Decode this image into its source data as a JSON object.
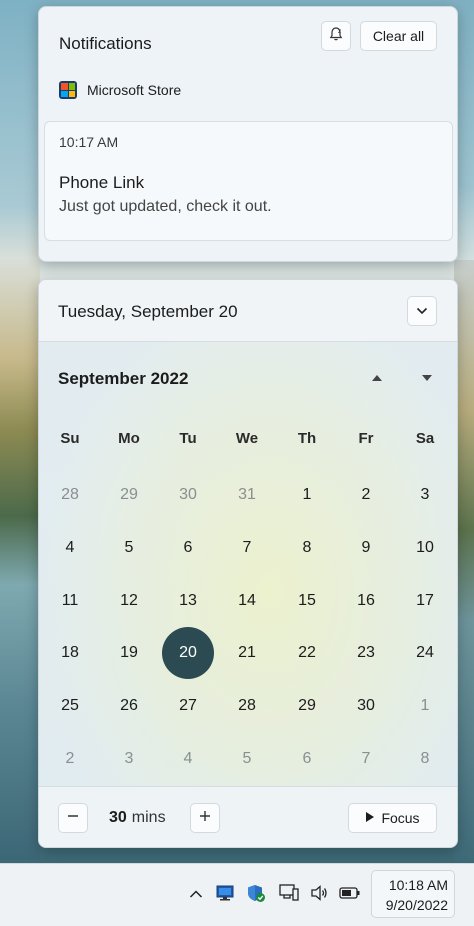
{
  "notifications": {
    "title": "Notifications",
    "do_not_disturb_icon": "bell-snooze-icon",
    "clear_all_label": "Clear all",
    "app_name": "Microsoft Store",
    "card": {
      "time": "10:17 AM",
      "title": "Phone Link",
      "body": "Just got updated, check it out."
    }
  },
  "calendar": {
    "header_date": "Tuesday, September 20",
    "month_label": "September 2022",
    "weekdays": [
      "Su",
      "Mo",
      "Tu",
      "We",
      "Th",
      "Fr",
      "Sa"
    ],
    "weeks": [
      [
        {
          "d": "28",
          "muted": true
        },
        {
          "d": "29",
          "muted": true
        },
        {
          "d": "30",
          "muted": true
        },
        {
          "d": "31",
          "muted": true
        },
        {
          "d": "1"
        },
        {
          "d": "2"
        },
        {
          "d": "3"
        }
      ],
      [
        {
          "d": "4"
        },
        {
          "d": "5"
        },
        {
          "d": "6"
        },
        {
          "d": "7"
        },
        {
          "d": "8"
        },
        {
          "d": "9"
        },
        {
          "d": "10"
        }
      ],
      [
        {
          "d": "11"
        },
        {
          "d": "12"
        },
        {
          "d": "13"
        },
        {
          "d": "14"
        },
        {
          "d": "15"
        },
        {
          "d": "16"
        },
        {
          "d": "17"
        }
      ],
      [
        {
          "d": "18"
        },
        {
          "d": "19"
        },
        {
          "d": "20",
          "today": true
        },
        {
          "d": "21"
        },
        {
          "d": "22"
        },
        {
          "d": "23"
        },
        {
          "d": "24"
        }
      ],
      [
        {
          "d": "25"
        },
        {
          "d": "26"
        },
        {
          "d": "27"
        },
        {
          "d": "28"
        },
        {
          "d": "29"
        },
        {
          "d": "30"
        },
        {
          "d": "1",
          "muted": true
        }
      ],
      [
        {
          "d": "2",
          "muted": true
        },
        {
          "d": "3",
          "muted": true
        },
        {
          "d": "4",
          "muted": true
        },
        {
          "d": "5",
          "muted": true
        },
        {
          "d": "6",
          "muted": true
        },
        {
          "d": "7",
          "muted": true
        },
        {
          "d": "8",
          "muted": true
        }
      ]
    ],
    "today_color": "#2c4a52"
  },
  "focus": {
    "minutes_value": "30",
    "minutes_unit": "mins",
    "focus_label": "Focus"
  },
  "taskbar": {
    "tray_icons": [
      "chevron-up-icon",
      "display-icon",
      "security-shield-icon",
      "network-icon",
      "volume-icon",
      "battery-icon"
    ],
    "time": "10:18 AM",
    "date": "9/20/2022"
  }
}
